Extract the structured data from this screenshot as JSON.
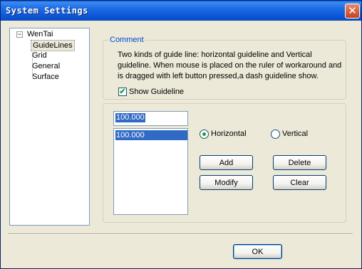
{
  "window": {
    "title": "System Settings",
    "close_symbol": "✕"
  },
  "tree": {
    "root": "WenTai",
    "expander_symbol": "−",
    "items": [
      "GuideLines",
      "Grid",
      "General",
      "Surface"
    ],
    "selected": "GuideLines"
  },
  "comment": {
    "legend": "Comment",
    "text": "Two kinds of guide line: horizontal  guideline and Vertical guideline. When mouse is placed on the ruler of workaround and is dragged with left button pressed,a dash guideline show."
  },
  "show_guideline": {
    "label": "Show Guideline",
    "checked": true
  },
  "guide": {
    "input_value": "100.000",
    "list_items": [
      "100.000"
    ],
    "orientation_options": [
      "Horizontal",
      "Vertical"
    ],
    "selected_orientation": "Horizontal"
  },
  "buttons": {
    "add": "Add",
    "delete": "Delete",
    "modify": "Modify",
    "clear": "Clear",
    "ok": "OK"
  }
}
